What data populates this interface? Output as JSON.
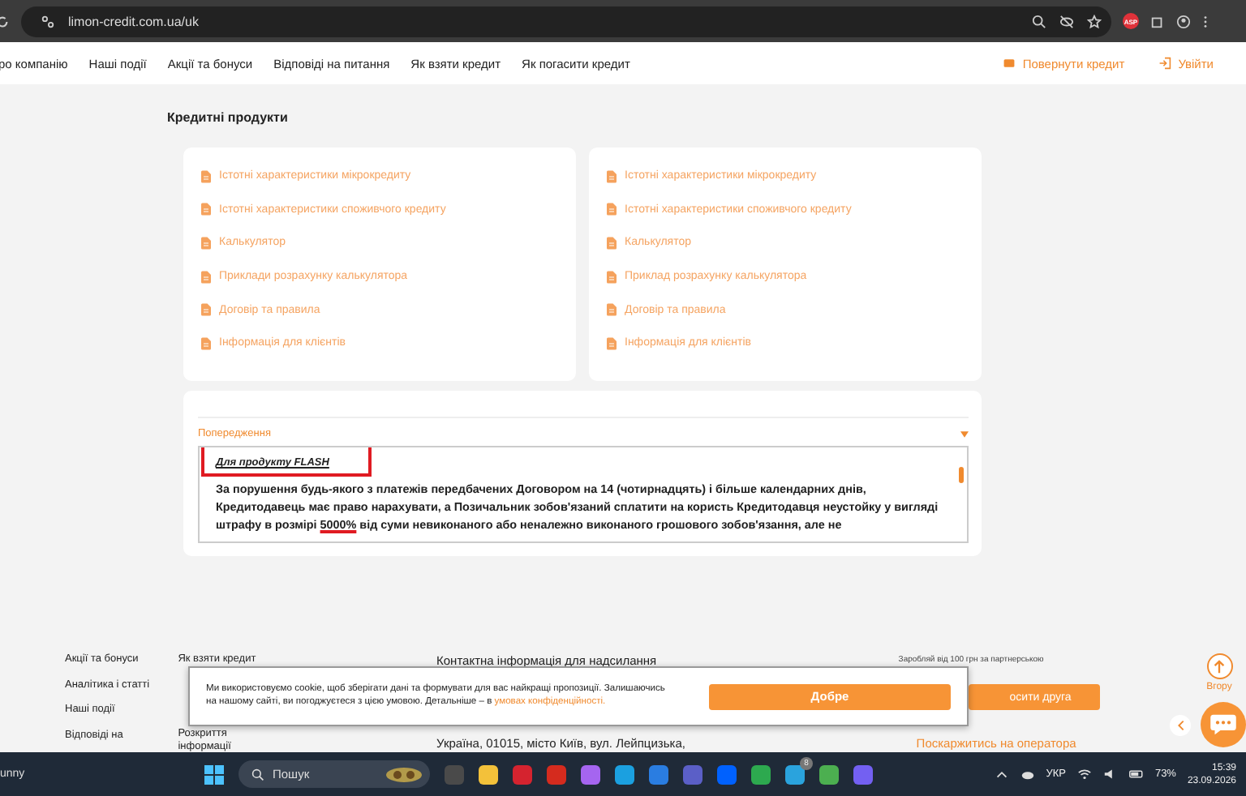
{
  "browser": {
    "url": "limon-credit.com.ua/uk",
    "profile_badge": "ASP"
  },
  "nav": {
    "items": [
      "ро компанію",
      "Наші події",
      "Акції та бонуси",
      "Відповіді на питання",
      "Як взяти кредит",
      "Як погасити кредит"
    ],
    "repay": "Повернути кредит",
    "login": "Увійти"
  },
  "heading": "Кредитні продукти",
  "cards": [
    {
      "links": [
        "Істотні характеристики мікрокредиту",
        "Істотні характеристики споживчого кредиту",
        "Калькулятор",
        "Приклади розрахунку калькулятора",
        "Договір та правила",
        "Інформація для клієнтів"
      ]
    },
    {
      "links": [
        "Істотні характеристики мікрокредиту",
        "Істотні характеристики споживчого кредиту",
        "Калькулятор",
        "Приклад розрахунку калькулятора",
        "Договір та правила",
        "Інформація для клієнтів"
      ]
    }
  ],
  "warning": {
    "title": "Попередження",
    "expanded": true,
    "subtitle": "Для продукту FLASH",
    "text_before": "За порушення будь-якого з платежів передбачених Договором на 14 (чотирнадцять) і більше календарних днів, Кредитодавець має право нарахувати, а Позичальник зобов'язаний сплатити на користь Кредитодавця неустойку у вигляді штрафу в розмірі ",
    "text_highlight": "5000%",
    "text_after": " від суми невиконаного або неналежно виконаного грошового зобов'язання, але не"
  },
  "footer": {
    "col1": [
      "Акції та бонуси",
      "Аналітика і статті",
      "Наші події",
      "Відповіді на"
    ],
    "col2": [
      "Як взяти кредит",
      "Розкриття інформації"
    ],
    "contact_title": "Контактна інформація для надсилання",
    "address": "Україна, 01015, місто Київ, вул. Лейпцизька,",
    "partner_note": "Заробляй від 100 грн за партнерською",
    "invite": "осити друга",
    "complain": "Поскаржитись на оператора",
    "up": "Вгору"
  },
  "cookie": {
    "text": "Ми використовуємо cookie, щоб зберігати дані та формувати для вас найкращі пропозиції. Залишаючись на нашому сайті, ви погоджуєтеся з цією умовою. Детальніше – в",
    "link": "умовах конфіденційності.",
    "button": "Добре"
  },
  "taskbar": {
    "weather": "unny",
    "search": "Пошук",
    "badge": "8",
    "lang": "УКР",
    "battery": "73%",
    "time": "15:39",
    "date": "23.09.2026"
  }
}
